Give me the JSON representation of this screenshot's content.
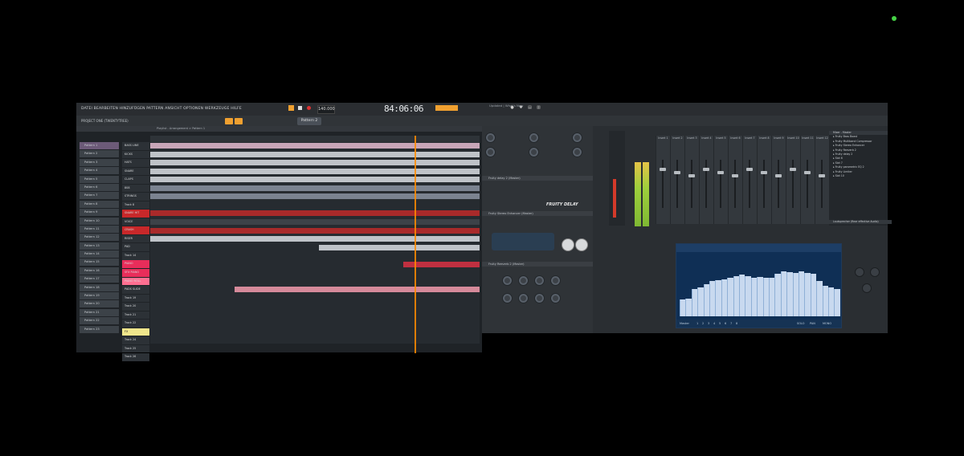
{
  "menu": {
    "label": "DATEI BEARBEITEN HINZUFÜGEN PATTERN ANSICHT OPTIONEN WERKZEUGE HILFE"
  },
  "project": {
    "name": "PROJECT ONE (TWENTYTREE)"
  },
  "playlist": {
    "breadcrumb": "Playlist - Arrangement > Pattern 1"
  },
  "transport": {
    "time": "84:06:06",
    "pattern": "Pattern 2",
    "hint": "Updated | What's New"
  },
  "patterns": [
    "Pattern 1",
    "Pattern 2",
    "Pattern 3",
    "Pattern 4",
    "Pattern 5",
    "Pattern 6",
    "Pattern 7",
    "Pattern 8",
    "Pattern 9",
    "Pattern 10",
    "Pattern 11",
    "Pattern 12",
    "Pattern 13",
    "Pattern 14",
    "Pattern 15",
    "Pattern 16",
    "Pattern 17",
    "Pattern 18",
    "Pattern 19",
    "Pattern 20",
    "Pattern 21",
    "Pattern 22",
    "Pattern 23"
  ],
  "tracks": [
    "BASS LINE",
    "KICKS",
    "HATS",
    "SNARE",
    "CLAPS",
    "808",
    "STRINGS",
    "Track 8",
    "SNARE HIT",
    "VOICE",
    "CRASH",
    "RISER",
    "PAD",
    "Track 14",
    "PIANO",
    "SFX PIANO",
    "PIANO ROLL",
    "PADS SLIDE",
    "Track 19",
    "Track 20",
    "Track 21",
    "Track 22",
    "FX",
    "Track 24",
    "Track 25",
    "Track 26"
  ],
  "plugins": {
    "delay": "Fruity delay 2 (Master)",
    "delay_logo": "FRUITY DELAY",
    "stereo": "Fruity Stereo Enhancer (Master)",
    "reverb": "Fruity Reeverb 2 (Master)"
  },
  "mixer": {
    "title": "Mixer - Master",
    "inserts": [
      "Insert 1",
      "Insert 2",
      "Insert 3",
      "Insert 4",
      "Insert 5",
      "Insert 6",
      "Insert 7",
      "Insert 8",
      "Insert 9",
      "Insert 10",
      "Insert 11",
      "Insert 12"
    ],
    "fx_slots": [
      "Fruity Bass Boost",
      "Fruity Multiband Compressor",
      "Fruity Stereo Enhancer",
      "Fruity Reeverb 2",
      "Fruity delay 2",
      "Slot 6",
      "Slot 7",
      "Fruity parametric EQ 2",
      "Fruity Limiter",
      "Slot 10"
    ],
    "output": "Lautsprecher (Rear effective Audio)"
  },
  "eq": {
    "title": "Fruity parametric EQ 2",
    "bands": [
      0.26,
      0.28,
      0.43,
      0.45,
      0.5,
      0.55,
      0.56,
      0.58,
      0.6,
      0.62,
      0.65,
      0.63,
      0.6,
      0.61,
      0.6,
      0.6,
      0.66,
      0.7,
      0.69,
      0.68,
      0.7,
      0.68,
      0.66,
      0.55,
      0.47,
      0.45,
      0.43
    ],
    "buttons": [
      "Master",
      "1",
      "2",
      "3",
      "4",
      "5",
      "6",
      "7",
      "8"
    ],
    "right_buttons": [
      "SOLO",
      "PAN",
      "MONO"
    ]
  },
  "colors": {
    "accent": "#f0a030",
    "playhead": "#ff8c00",
    "eq_bg": "#0f2f55"
  }
}
